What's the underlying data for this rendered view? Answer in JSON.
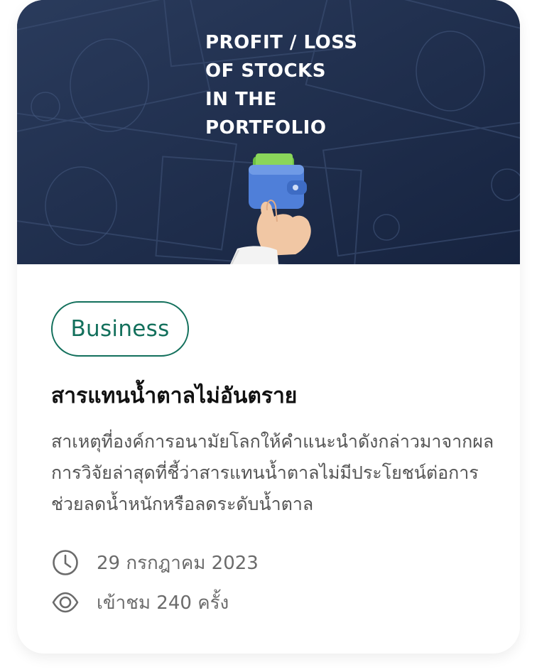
{
  "hero": {
    "title": "PROFIT / LOSS\nOF STOCKS\nIN THE\nPORTFOLIO"
  },
  "tag": {
    "label": "Business"
  },
  "article": {
    "title": "สารแทนน้ำตาลไม่อันตราย",
    "description": "สาเหตุที่องค์การอนามัยโลกให้คำแนะนำดังกล่าวมาจากผลการวิจัยล่าสุดที่ชี้ว่าสารแทนน้ำตาลไม่มีประโยชน์ต่อการช่วยลดน้ำหนักหรือลดระดับน้ำตาล",
    "date": "29 กรกฎาคม 2023",
    "views": "เข้าชม 240 ครั้ง"
  },
  "icons": {
    "date": "clock-icon",
    "views": "eye-icon",
    "hero_art": "wallet-hand-icon"
  },
  "colors": {
    "accent": "#13705c",
    "hero_bg": "#1c2c4d",
    "title": "#111111",
    "body_text": "#555555",
    "meta_text": "#6b6b6b"
  }
}
